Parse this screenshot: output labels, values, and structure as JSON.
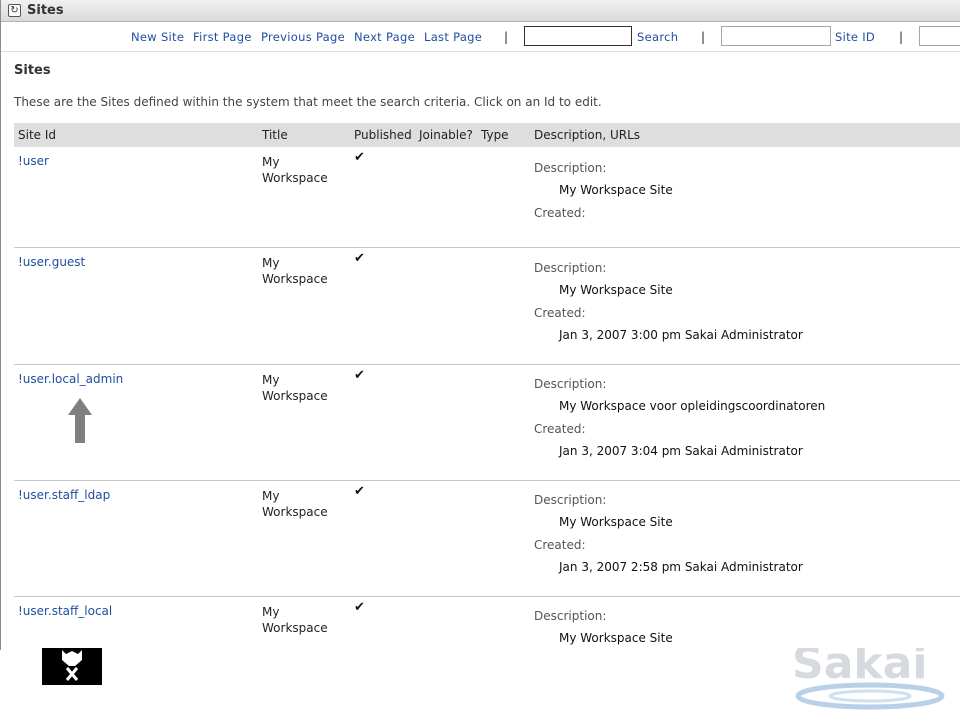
{
  "window": {
    "title": "Sites",
    "reset_icon": "refresh-icon"
  },
  "toolbar": {
    "new_site": "New Site",
    "first_page": "First Page",
    "previous_page": "Previous Page",
    "next_page": "Next Page",
    "last_page": "Last Page",
    "separator": "|",
    "search_value": "",
    "search_link": "Search",
    "site_id_value": "",
    "site_id_link": "Site ID",
    "extra_value": ""
  },
  "main": {
    "heading": "Sites",
    "instructions": "These are the Sites defined within the system that meet the search criteria. Click on an Id to edit."
  },
  "table": {
    "headers": {
      "site_id": "Site Id",
      "title": "Title",
      "published": "Published",
      "joinable": "Joinable?",
      "type": "Type",
      "description": "Description, URLs"
    },
    "description_label": "Description:",
    "created_label": "Created:",
    "check_mark": "✔",
    "rows": [
      {
        "id": "!user",
        "title": "My Workspace",
        "published": true,
        "description": "My Workspace Site",
        "created": ""
      },
      {
        "id": "!user.guest",
        "title": "My Workspace",
        "published": true,
        "description": "My Workspace Site",
        "created": "Jan 3, 2007 3:00 pm Sakai Administrator"
      },
      {
        "id": "!user.local_admin",
        "title": "My Workspace",
        "published": true,
        "description": "My Workspace voor opleidingscoordinatoren",
        "created": "Jan 3, 2007 3:04 pm Sakai Administrator"
      },
      {
        "id": "!user.staff_ldap",
        "title": "My Workspace",
        "published": true,
        "description": "My Workspace Site",
        "created": "Jan 3, 2007 2:58 pm Sakai Administrator"
      },
      {
        "id": "!user.staff_local",
        "title": "My Workspace",
        "published": true,
        "description": "My Workspace Site",
        "created": ""
      }
    ]
  },
  "annotation": {
    "icon": "up-arrow-icon",
    "color": "#808080"
  },
  "footer": {
    "left_logo": "university-logo",
    "right_logo": "sakai-logo",
    "right_logo_text": "Sakai"
  }
}
